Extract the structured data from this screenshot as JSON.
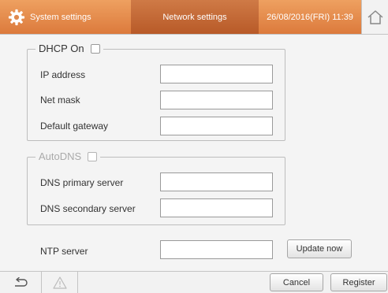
{
  "header": {
    "system_settings": "System settings",
    "network_settings": "Network settings",
    "datetime": "26/08/2016(FRI) 11:39"
  },
  "dhcp": {
    "label": "DHCP On",
    "checked": false,
    "fields": [
      {
        "label": "IP address",
        "value": ""
      },
      {
        "label": "Net mask",
        "value": ""
      },
      {
        "label": "Default gateway",
        "value": ""
      }
    ]
  },
  "autodns": {
    "label": "AutoDNS",
    "checked": false,
    "fields": [
      {
        "label": "DNS primary server",
        "value": ""
      },
      {
        "label": "DNS secondary server",
        "value": ""
      }
    ]
  },
  "ntp": {
    "label": "NTP server",
    "value": "",
    "update_label": "Update now"
  },
  "footer": {
    "cancel_label": "Cancel",
    "register_label": "Register"
  },
  "colors": {
    "header_orange": "#e48a4c",
    "header_active": "#c2652f"
  },
  "icons": {
    "settings": "gear-icon",
    "home": "home-icon",
    "back": "back-arrow-icon",
    "warning": "warning-icon"
  }
}
